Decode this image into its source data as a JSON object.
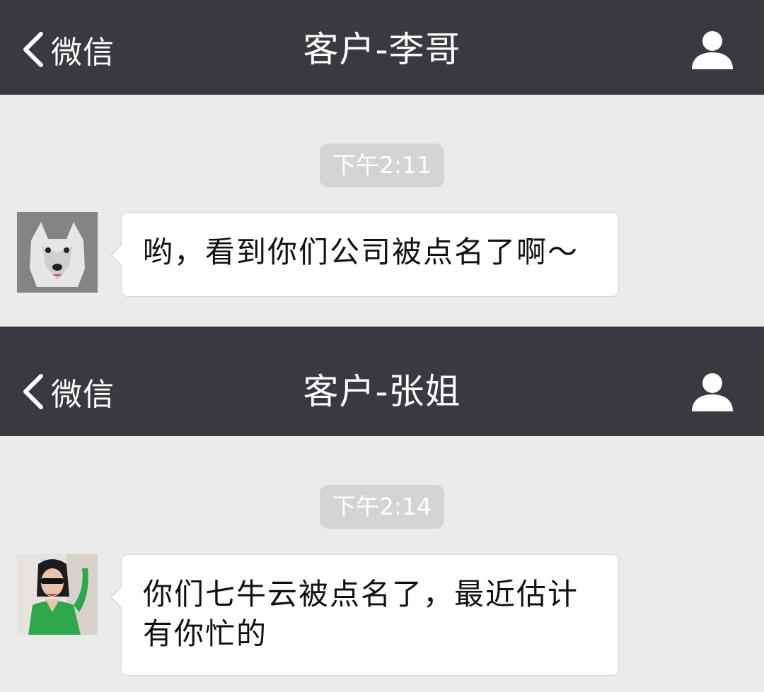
{
  "colors": {
    "navbar_bg": "#393a3f",
    "chat_bg": "#ebebeb",
    "time_badge_bg": "#d4d4d4",
    "bubble_bg": "#ffffff"
  },
  "chats": [
    {
      "nav": {
        "back_icon": "chevron-left-icon",
        "back_label": "微信",
        "title": "客户-李哥",
        "profile_icon": "person-icon"
      },
      "time": "下午2:11",
      "message": {
        "avatar": "wolf-avatar",
        "text": "哟，看到你们公司被点名了啊～"
      }
    },
    {
      "nav": {
        "back_icon": "chevron-left-icon",
        "back_label": "微信",
        "title": "客户-张姐",
        "profile_icon": "person-icon"
      },
      "time": "下午2:14",
      "message": {
        "avatar": "woman-green-dress-avatar",
        "text": "你们七牛云被点名了，最近估计有你忙的"
      }
    }
  ]
}
